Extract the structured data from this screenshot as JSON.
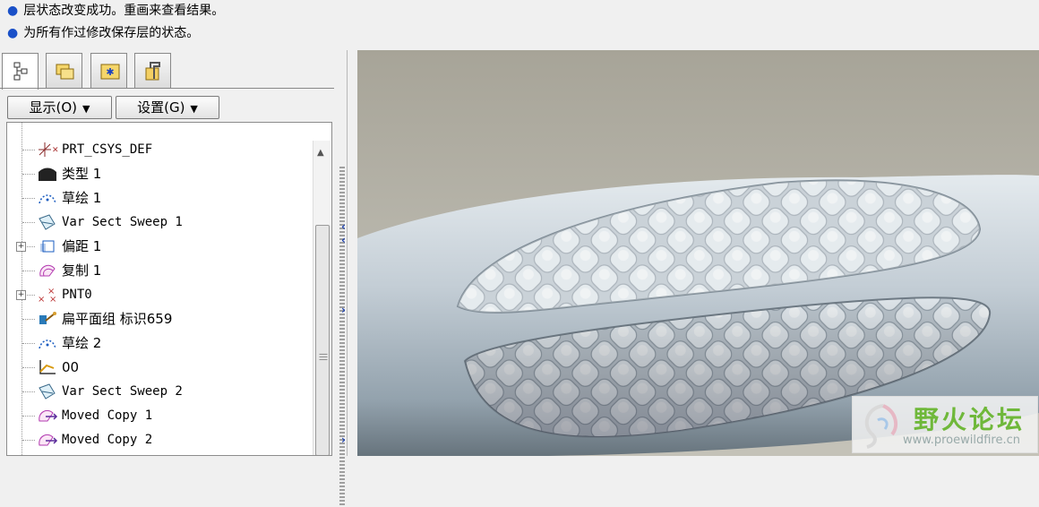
{
  "messages": [
    "层状态改变成功。重画来查看结果。",
    "为所有作过修改保存层的状态。"
  ],
  "tabs": [
    {
      "name": "model-tree-tab",
      "icon": "model-tree-icon"
    },
    {
      "name": "folder-browser-tab",
      "icon": "folder-icon"
    },
    {
      "name": "favorites-tab",
      "icon": "favorites-icon"
    },
    {
      "name": "connections-tab",
      "icon": "tools-icon"
    }
  ],
  "toolbar": {
    "show_label": "显示(O)",
    "settings_label": "设置(G)"
  },
  "tree": {
    "items": [
      {
        "label": "PRT_CSYS_DEF",
        "icon": "csys-icon",
        "mono": true,
        "expandable": false
      },
      {
        "label": "类型 1",
        "icon": "type-feature-icon",
        "mono": false,
        "expandable": false
      },
      {
        "label": "草绘 1",
        "icon": "sketch-icon",
        "mono": false,
        "expandable": false
      },
      {
        "label": "Var Sect Sweep 1",
        "icon": "sweep-icon",
        "mono": true,
        "expandable": false
      },
      {
        "label": "偏距 1",
        "icon": "offset-icon",
        "mono": false,
        "expandable": true
      },
      {
        "label": "复制 1",
        "icon": "copy-icon",
        "mono": false,
        "expandable": false
      },
      {
        "label": "PNT0",
        "icon": "datum-point-icon",
        "mono": true,
        "expandable": true
      },
      {
        "label": "扁平面组 标识659",
        "icon": "flatten-quilt-icon",
        "mono": false,
        "expandable": false
      },
      {
        "label": "草绘 2",
        "icon": "sketch-icon",
        "mono": false,
        "expandable": false
      },
      {
        "label": "00",
        "icon": "graph-icon",
        "mono": false,
        "expandable": false
      },
      {
        "label": "Var Sect Sweep 2",
        "icon": "sweep-icon",
        "mono": true,
        "expandable": false
      },
      {
        "label": "Moved Copy 1",
        "icon": "moved-copy-icon",
        "mono": true,
        "expandable": false
      },
      {
        "label": "Moved Copy 2",
        "icon": "moved-copy-icon",
        "mono": true,
        "expandable": false
      }
    ]
  },
  "watermark": {
    "name": "野火论坛",
    "url": "www.proewildfire.cn"
  },
  "colors": {
    "bullet": "#1a50c8",
    "viewport_bg": "#b3b1a6",
    "model_surface": "#c8d2da",
    "watermark_green": "#6fb83a"
  }
}
